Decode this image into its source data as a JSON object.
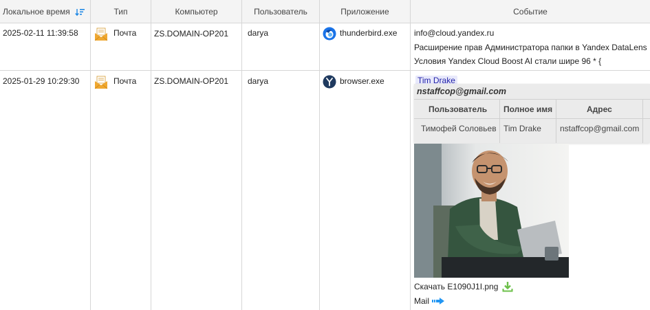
{
  "columns": {
    "local_time": "Локальное время",
    "type": "Тип",
    "computer": "Компьютер",
    "user": "Пользователь",
    "app": "Приложение",
    "event": "Событие"
  },
  "rows": [
    {
      "time": "2025-02-11 11:39:58",
      "type": "Почта",
      "computer": "ZS.DOMAIN-OP201",
      "user": "darya",
      "app": "thunderbird.exe",
      "app_icon": "thunderbird-icon",
      "event_lines": [
        "info@cloud.yandex.ru",
        "Расширение прав Администратора папки в Yandex DataLens",
        "Условия Yandex Cloud Boost AI стали шире 96 * {"
      ]
    },
    {
      "time": "2025-01-29 10:29:30",
      "type": "Почта",
      "computer": "ZS.DOMAIN-OP201",
      "user": "darya",
      "app": "browser.exe",
      "app_icon": "yandex-browser-icon",
      "event_tag": "Tim Drake",
      "popup": {
        "title": "nstaffcop@gmail.com",
        "headers": [
          "Пользователь",
          "Полное имя",
          "Адрес"
        ],
        "cells": [
          "Тимофей Соловьев",
          "Tim Drake",
          "nstaffcop@gmail.com"
        ]
      },
      "download_label": "Скачать E1090J1I.png",
      "mail_link": "Mail"
    }
  ],
  "colors": {
    "accent": "#1e88e5",
    "mail_icon": "#f0a830",
    "tag_bg": "#e8e9fb",
    "download_green": "#6cc04a",
    "arrow_blue": "#2196f3"
  }
}
